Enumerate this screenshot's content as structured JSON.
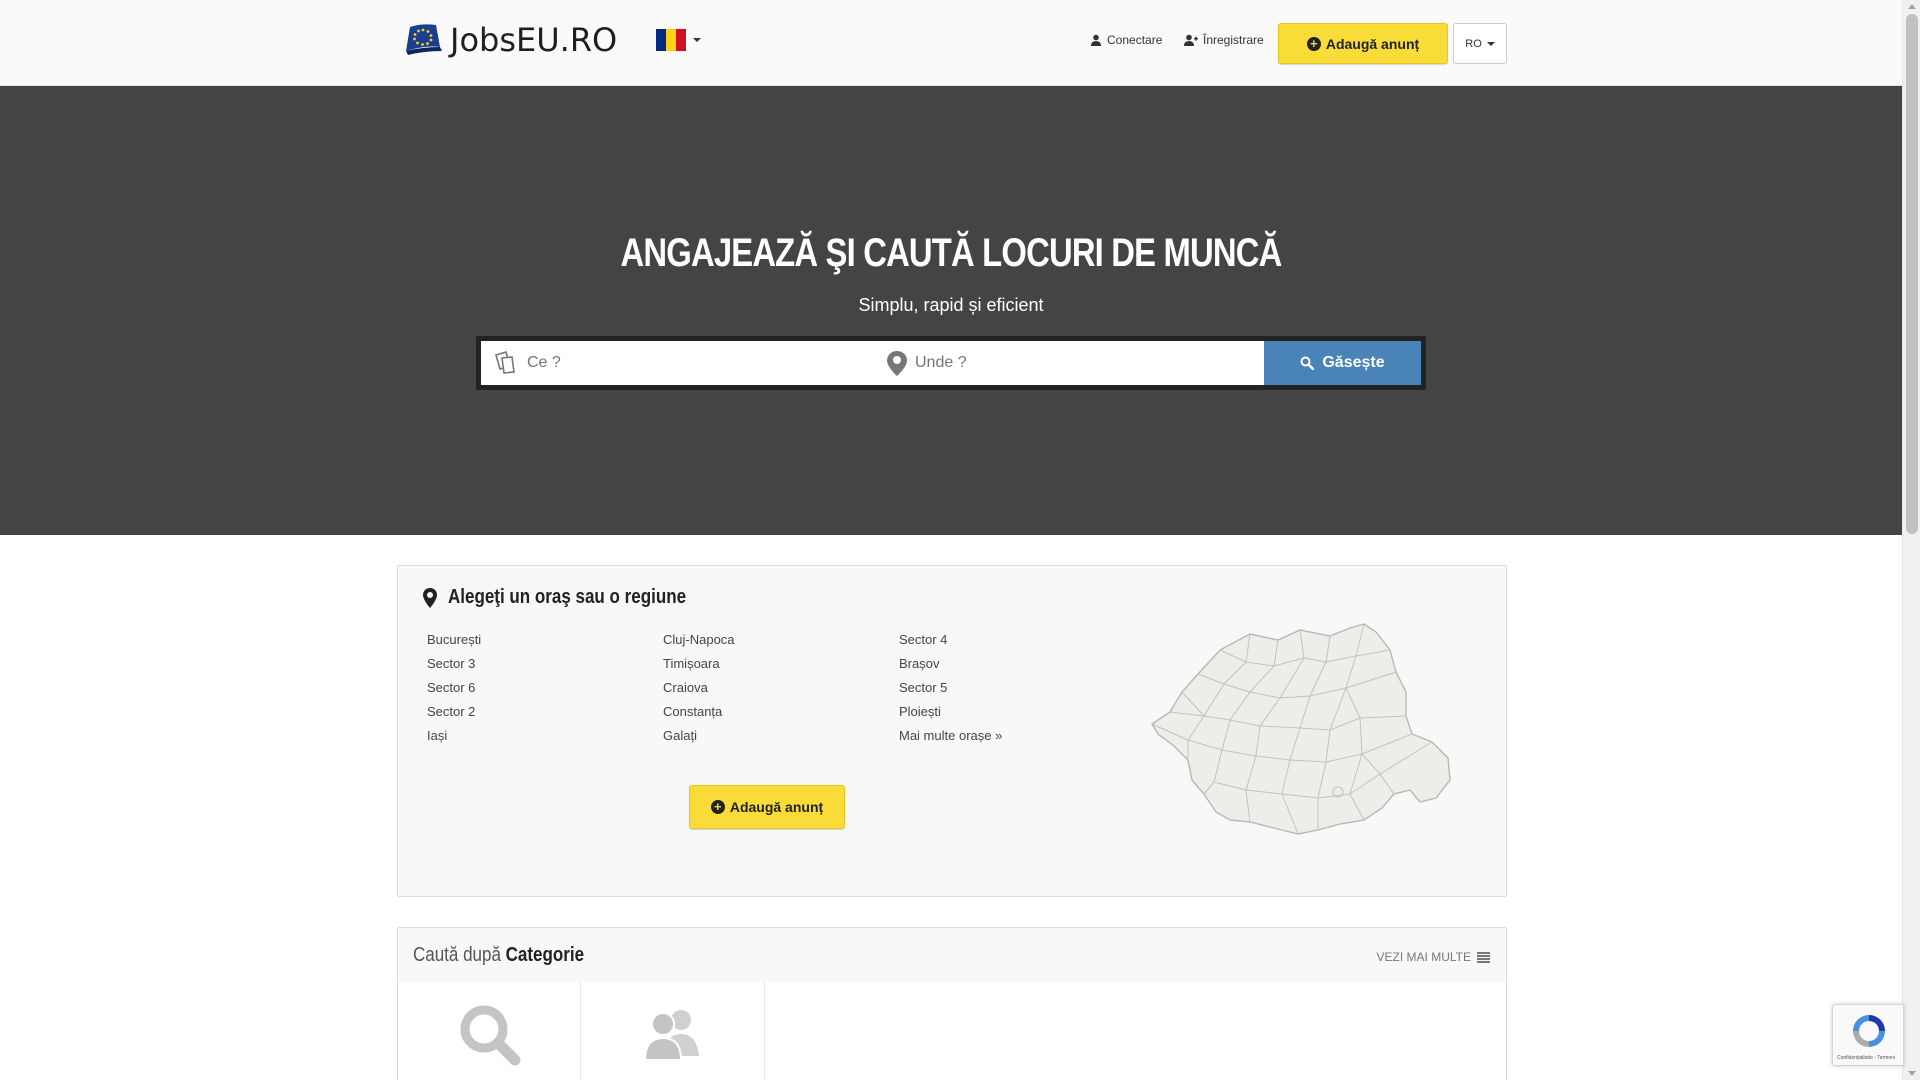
{
  "header": {
    "logo_text": "JobsEU.RO",
    "login_label": "Conectare",
    "register_label": "Înregistrare",
    "add_ad_label": "Adaugă anunț",
    "language_code": "RO"
  },
  "hero": {
    "title": "ANGAJEAZĂ ŞI CAUTĂ LOCURI DE MUNCĂ",
    "subtitle": "Simplu, rapid și eficient",
    "what_placeholder": "Ce ?",
    "where_placeholder": "Unde ?",
    "search_button": "Găsește"
  },
  "cities": {
    "title": "Alegeţi un oraş sau o regiune",
    "columns": [
      [
        "București",
        "Sector 3",
        "Sector 6",
        "Sector 2",
        "Iași"
      ],
      [
        "Cluj-Napoca",
        "Timișoara",
        "Craiova",
        "Constanța",
        "Galați"
      ],
      [
        "Sector 4",
        "Brașov",
        "Sector 5",
        "Ploiești",
        "Mai multe orașe »"
      ]
    ],
    "add_ad_label": "Adaugă anunț"
  },
  "categories": {
    "title_light": "Caută după",
    "title_bold": "Categorie",
    "see_more": "VEZI MAI MULTE"
  },
  "recaptcha": {
    "links": "Confidențialitate - Termeni"
  },
  "colors": {
    "hero_bg": "#444444",
    "accent_yellow": "#f9dc38",
    "search_blue": "#4a83b7",
    "flag_blue": "#002b7f",
    "flag_yellow": "#fcd116",
    "flag_red": "#ce1126"
  }
}
